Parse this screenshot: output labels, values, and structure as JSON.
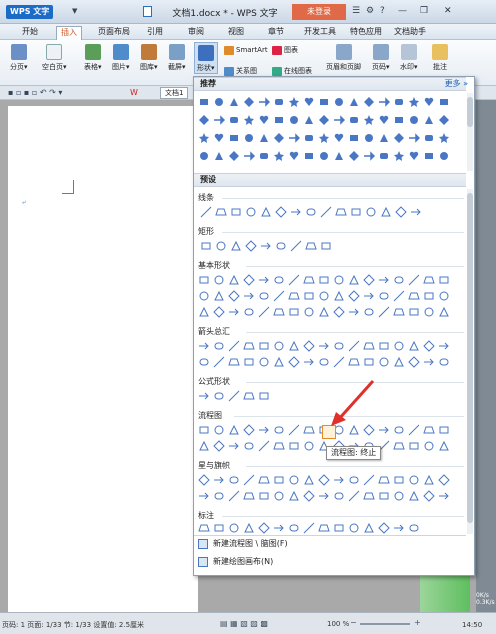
{
  "titlebar": {
    "app_name": "WPS 文字",
    "doc_title": "文档1.docx * - WPS 文字",
    "signin": "未登录"
  },
  "menu": {
    "tabs": [
      "开始",
      "插入",
      "页面布局",
      "引用",
      "审阅",
      "视图",
      "章节",
      "开发工具",
      "特色应用",
      "文档助手"
    ],
    "active_tab": "插入"
  },
  "ribbon": {
    "buttons": [
      "分页",
      "空白页",
      "表格",
      "图片",
      "图库",
      "截屏",
      "形状",
      "关系图",
      "在线图表",
      "页眉和页脚",
      "页码",
      "水印",
      "批注"
    ],
    "smartart": "SmartArt",
    "chart": "图表"
  },
  "quickaccess": {
    "doc_tab": "文档1"
  },
  "shapes_panel": {
    "recommend_label": "推荐",
    "more_label": "更多",
    "preset_label": "预设",
    "sections": [
      "线条",
      "矩形",
      "基本形状",
      "箭头总汇",
      "公式形状",
      "流程图",
      "星与旗帜",
      "标注"
    ],
    "commands": [
      "新建流程图 \\ 脑图(F)",
      "新建绘图画布(N)"
    ],
    "tooltip": "流程图: 终止"
  },
  "statusbar": {
    "text": "页码: 1  页面: 1/33  节: 1/33  设置值: 2.5厘米",
    "zoom": "100 %",
    "clock": "14:50",
    "net_up": "0K/s",
    "net_down": "0.3K/s"
  },
  "colors": {
    "accent": "#1b6bc7",
    "signin": "#e06a48",
    "arrow": "#e0302a",
    "shape_fill": "#4a77c4"
  }
}
